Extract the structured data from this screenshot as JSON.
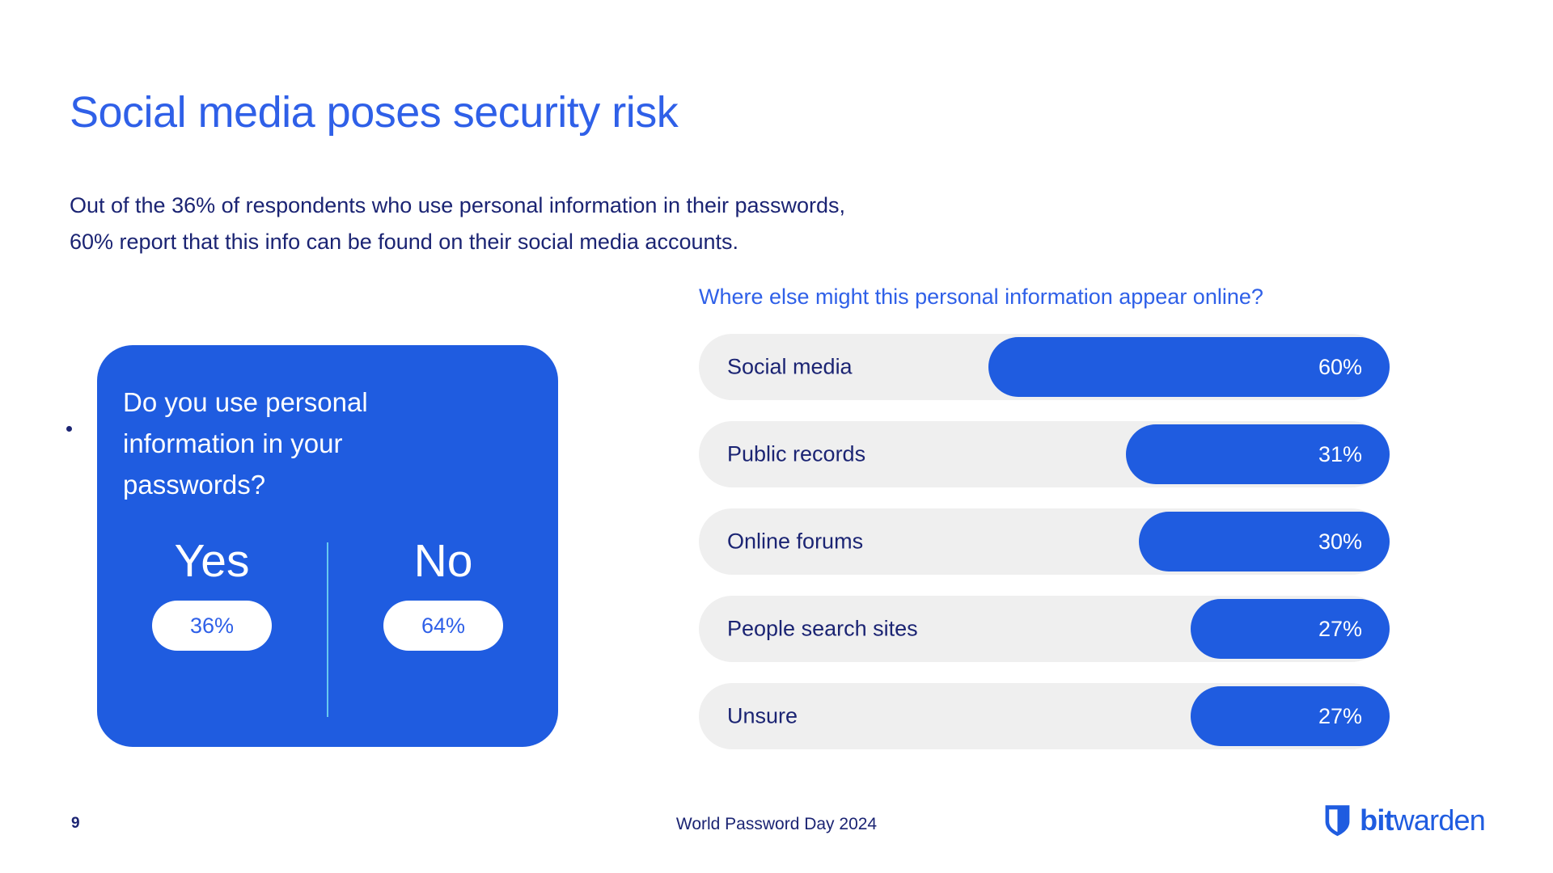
{
  "header": {
    "title": "Social media poses security risk",
    "subtitle_line1": "Out of the 36% of respondents who use personal information in their passwords,",
    "subtitle_line2": "60% report that this info can be found on their social media accounts."
  },
  "question_card": {
    "question": "Do you use personal information in your passwords?",
    "answers": [
      {
        "label": "Yes",
        "value": "36%"
      },
      {
        "label": "No",
        "value": "64%"
      }
    ]
  },
  "chart_data": {
    "type": "bar",
    "title": "Where else might this personal information appear online?",
    "xlabel": "",
    "ylabel": "",
    "orientation": "horizontal",
    "grid": false,
    "legend": null,
    "xlim": [
      0,
      100
    ],
    "unit": "%",
    "categories": [
      "Social media",
      "Public records",
      "Online forums",
      "People search sites",
      "Unsure"
    ],
    "values": [
      60,
      31,
      30,
      27,
      27
    ],
    "value_labels": [
      "60%",
      "31%",
      "30%",
      "27%",
      "27%"
    ],
    "bar_pixel_fractions": [
      0.585,
      0.385,
      0.365,
      0.29,
      0.29
    ]
  },
  "secondary_chart": {
    "type": "pie",
    "title": "Do you use personal information in your passwords?",
    "categories": [
      "Yes",
      "No"
    ],
    "values": [
      36,
      64
    ],
    "value_labels": [
      "36%",
      "64%"
    ]
  },
  "footer": {
    "page_number": "9",
    "center_text": "World Password Day 2024",
    "logo_bit": "bit",
    "logo_warden": "warden",
    "logo_icon": "shield-icon"
  },
  "colors": {
    "brand_blue": "#1f5ce0",
    "title_blue": "#2f60e8",
    "navy_text": "#1b2473",
    "track_gray": "#efefef",
    "divider_cyan": "#67c8ef",
    "white": "#ffffff"
  }
}
